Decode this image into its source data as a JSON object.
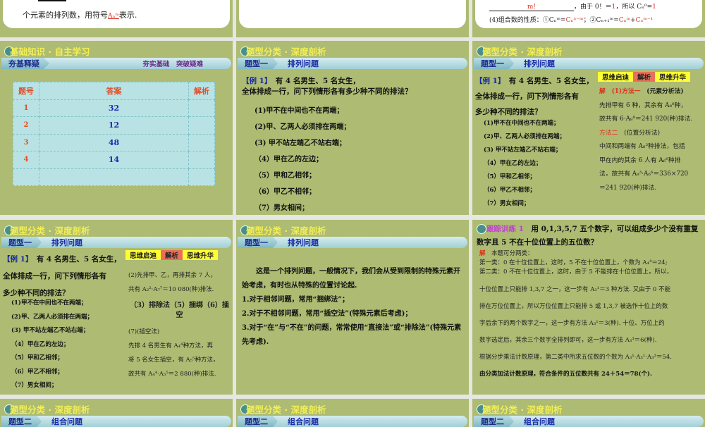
{
  "top": {
    "s1": {
      "text": "个元素的排列数，用符号",
      "symbol": "Aₙᵐ",
      "tail": "表示."
    },
    "s3": {
      "line1_num": "m!",
      "line1": "，由于 0！＝",
      "v1": "1",
      "line1b": "，所以 Cₙ⁰=",
      "v2": "1",
      "line2": "(4)组合数的性质：①Cₙᵐ=",
      "c1": "Cₙⁿ⁻ᵐ",
      "line2b": "；②Cₙ₊₁ᵐ=",
      "c2": "Cₙᵐ",
      "plus": "+",
      "c3": "Cₙᵐ⁻¹"
    }
  },
  "sec_basic": "基础知识 · 自主学习",
  "sec_type": "题型分类 · 深度剖析",
  "basic_bar": {
    "tag": "夯基释疑",
    "right": "夯实基础　突破疑难"
  },
  "answer_table": {
    "headers": [
      "题号",
      "答案",
      "解析"
    ],
    "rows": [
      [
        "1",
        "32",
        ""
      ],
      [
        "2",
        "12",
        ""
      ],
      [
        "3",
        "48",
        ""
      ],
      [
        "4",
        "14",
        ""
      ],
      [
        "",
        "",
        ""
      ]
    ]
  },
  "type1": {
    "tag": "题型一",
    "label": "排列问题"
  },
  "type2": {
    "tag": "题型二",
    "label": "组合问题"
  },
  "example": {
    "label": "【例 1】",
    "q1": "有 4 名男生、5 名女生，",
    "q2": "全体排成一行，问下列情形各有",
    "q3": "多少种不同的排法？",
    "items": [
      "(1)甲不在中间也不在两端；",
      "(2)甲、乙两人必须排在两端；",
      "(3) 甲不站左端乙不站右端；",
      "（4）甲在乙的左边；",
      "（5）甲和乙相邻；",
      "（6）甲乙不相邻；",
      "（7）男女相间；"
    ]
  },
  "example_tabs": [
    "思维启迪",
    "解析",
    "思维升华"
  ],
  "sol1": {
    "jie": "解",
    "m1": "(1)方法一",
    "m1b": "(元素分析法)",
    "l1": "先排甲有 6 种，其余有 A₈⁸种，",
    "l2": "故共有 6·A₈⁸＝241 920(种)排法.",
    "m2": "方法二",
    "m2b": "(位置分析法)",
    "l3": "中间和两端有 A₈³种排法，包括",
    "l4": "甲在内的其余 6 人有 A₆⁶种排",
    "l5": "法，故共有 A₈³·A₆⁶＝336×720",
    "l6": "＝241 920(种)排法."
  },
  "sol2": {
    "l1": "(2)先排甲、乙，再排其余 7 人，",
    "l2": "共有 A₂²·A₇⁷＝10 080(种)排法.",
    "l3": "（3）排除法（5）捆绑（6）插空",
    "l4": "(7)(插空法)",
    "l5": "先排 4 名男生有 A₄⁴种方法，再",
    "l6": "将 5 名女生插空，有 A₅⁵种方法，",
    "l7": "故共有 A₄⁴·A₅⁵＝2 880(种)排法."
  },
  "think": {
    "p1": "这是一个排列问题，一般情况下，我们会从受到限制的特殊元素开始考虑，有时也从特殊的位置讨论起.",
    "p2": "1.对于相邻问题，常用“捆绑法”；",
    "p3": "2.对于不相邻问题，常用“插空法”(特殊元素后考虑)；",
    "p4": "3.对于“在”与“不在”的问题，常常使用“直接法”或“排除法”(特殊元素先考虑)."
  },
  "practice": {
    "label": "跟踪训练 1",
    "q": "用 0,1,3,5,7 五个数字，可以组成多少个没有重复数字且 5 不在十位位置上的五位数？",
    "jie": "解",
    "l0": "本题可分两类：",
    "l1": "第一类：0 在十位位置上，这时，5 不在十位位置上，个数为 A₄⁴＝24;",
    "l2": "第二类：0 不在十位位置上，这时，由于 5 不能排在十位位置上，所以，",
    "l3": "十位位置上只能排 1,3,7 之一，这一步有 A₃¹＝3 种方法. 又由于 0 不能",
    "l4": "排在万位位置上，所以万位位置上只能排 5 或 1,3,7 被选作十位上的数",
    "l5": "字后余下的两个数字之一，这一步有方法 A₃¹＝3(种). 十位、万位上的",
    "l6": "数字选定后，其余三个数字全排列即可，这一步有方法 A₃³＝6(种).",
    "l7": "根据分步乘法计数原理，第二类中所求五位数的个数为 A₃¹·A₃¹·A₃³＝54.",
    "l8": "由分类加法计数原理，符合条件的五位数共有 24＋54＝78(个)."
  }
}
